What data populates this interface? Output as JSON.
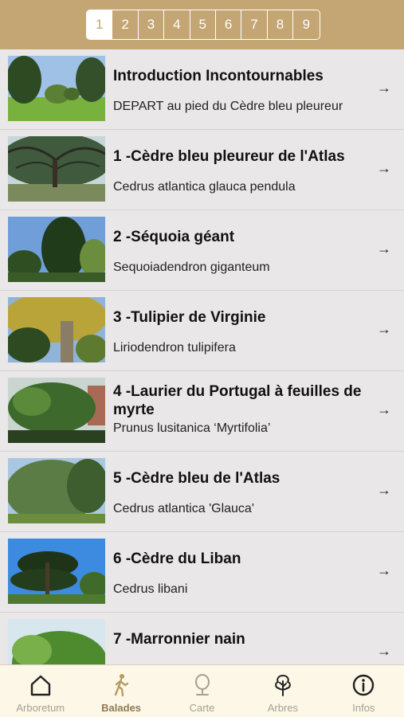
{
  "pager": {
    "pages": [
      "1",
      "2",
      "3",
      "4",
      "5",
      "6",
      "7",
      "8",
      "9"
    ],
    "active_index": 0
  },
  "items": [
    {
      "title": "Introduction Incontournables",
      "subtitle": "DEPART au pied du Cèdre bleu pleureur"
    },
    {
      "title": "1 -Cèdre bleu pleureur de l'Atlas",
      "subtitle": "Cedrus atlantica glauca pendula"
    },
    {
      "title": "2 -Séquoia géant",
      "subtitle": "Sequoiadendron giganteum"
    },
    {
      "title": "3 -Tulipier de Virginie",
      "subtitle": "Liriodendron tulipifera"
    },
    {
      "title": "4 -Laurier du Portugal à feuilles de myrte",
      "subtitle": "Prunus lusitanica ‘Myrtifolia’"
    },
    {
      "title": "5 -Cèdre bleu de l'Atlas",
      "subtitle": "Cedrus atlantica 'Glauca'"
    },
    {
      "title": "6 -Cèdre du Liban",
      "subtitle": "Cedrus libani"
    },
    {
      "title": "7 -Marronnier nain",
      "subtitle": ""
    }
  ],
  "arrow_glyph": "→",
  "tabbar": {
    "tabs": [
      {
        "label": "Arboretum",
        "icon": "home-icon"
      },
      {
        "label": "Balades",
        "icon": "walker-icon"
      },
      {
        "label": "Carte",
        "icon": "map-pin-icon"
      },
      {
        "label": "Arbres",
        "icon": "tree-icon"
      },
      {
        "label": "Infos",
        "icon": "info-icon"
      }
    ],
    "active_index": 1
  },
  "colors": {
    "topbar": "#c3a673",
    "tab_active": "#8f7a55",
    "tab_inactive": "#a69f95",
    "background": "#e9e7e8"
  }
}
